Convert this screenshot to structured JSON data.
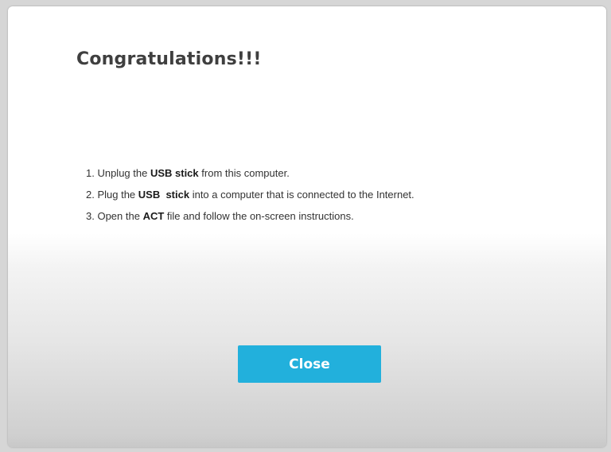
{
  "dialog": {
    "title": "Congratulations!!!",
    "steps": [
      {
        "prefix": "1. Unplug the ",
        "bold": "USB stick",
        "suffix": " from this computer."
      },
      {
        "prefix": "2. Plug the ",
        "bold": "USB  stick",
        "suffix": " into a computer that is connected to the Internet."
      },
      {
        "prefix": "3. Open the ",
        "bold": "ACT",
        "suffix": " file and follow the on-screen instructions."
      }
    ],
    "close_label": "Close"
  },
  "colors": {
    "button": "#22b0dc",
    "title": "#3f3f3f",
    "backdrop": "#d6d6d6"
  }
}
